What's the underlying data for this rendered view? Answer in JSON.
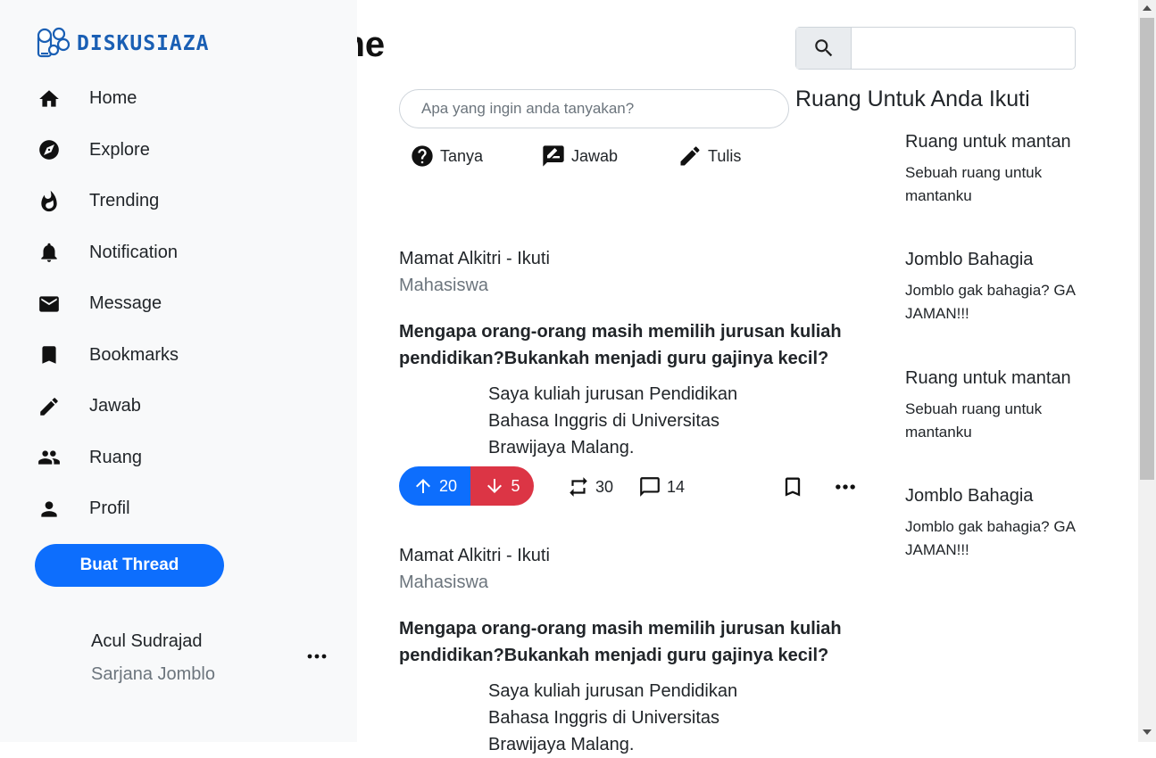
{
  "app": {
    "logo_text": "DISKUSIAZA"
  },
  "sidebar": {
    "items": [
      {
        "label": "Home",
        "icon": "home-icon"
      },
      {
        "label": "Explore",
        "icon": "compass-icon"
      },
      {
        "label": "Trending",
        "icon": "flame-icon"
      },
      {
        "label": "Notification",
        "icon": "bell-icon"
      },
      {
        "label": "Message",
        "icon": "mail-icon"
      },
      {
        "label": "Bookmarks",
        "icon": "bookmark-icon"
      },
      {
        "label": "Jawab",
        "icon": "pencil-icon"
      },
      {
        "label": "Ruang",
        "icon": "people-icon"
      },
      {
        "label": "Profil",
        "icon": "person-icon"
      }
    ],
    "create_button": "Buat Thread",
    "user": {
      "name": "Acul Sudrajad",
      "role": "Sarjana Jomblo"
    }
  },
  "header": {
    "title": "Home",
    "search_placeholder": ""
  },
  "composer": {
    "placeholder": "Apa yang ingin anda tanyakan?",
    "actions": [
      {
        "label": "Tanya",
        "icon": "question-icon"
      },
      {
        "label": "Jawab",
        "icon": "answer-icon"
      },
      {
        "label": "Tulis",
        "icon": "pencil-icon"
      }
    ]
  },
  "posts": [
    {
      "author": "Mamat Alkitri - Ikuti",
      "role": "Mahasiswa",
      "title": "Mengapa orang-orang masih memilih jurusan kuliah pendidikan?Bukankah menjadi guru gajinya kecil?",
      "body": "Saya kuliah jurusan Pendidikan Bahasa Inggris di Universitas Brawijaya Malang.",
      "upvotes": "20",
      "downvotes": "5",
      "reposts": "30",
      "comments": "14"
    },
    {
      "author": "Mamat Alkitri - Ikuti",
      "role": "Mahasiswa",
      "title": "Mengapa orang-orang masih memilih jurusan kuliah pendidikan?Bukankah menjadi guru gajinya kecil?",
      "body": "Saya kuliah jurusan Pendidikan Bahasa Inggris di Universitas Brawijaya Malang."
    }
  ],
  "rooms": {
    "title": "Ruang Untuk Anda Ikuti",
    "items": [
      {
        "name": "Ruang untuk mantan",
        "desc": "Sebuah ruang untuk mantanku"
      },
      {
        "name": "Jomblo Bahagia",
        "desc": "Jomblo gak bahagia? GA JAMAN!!!"
      },
      {
        "name": "Ruang untuk mantan",
        "desc": "Sebuah ruang untuk mantanku"
      },
      {
        "name": "Jomblo Bahagia",
        "desc": "Jomblo gak bahagia? GA JAMAN!!!"
      }
    ]
  },
  "colors": {
    "primary": "#0d6efd",
    "danger": "#dc3545",
    "sidebar_bg": "#f8f9fa",
    "muted": "#6c757d",
    "logo": "#1a5fb4"
  }
}
